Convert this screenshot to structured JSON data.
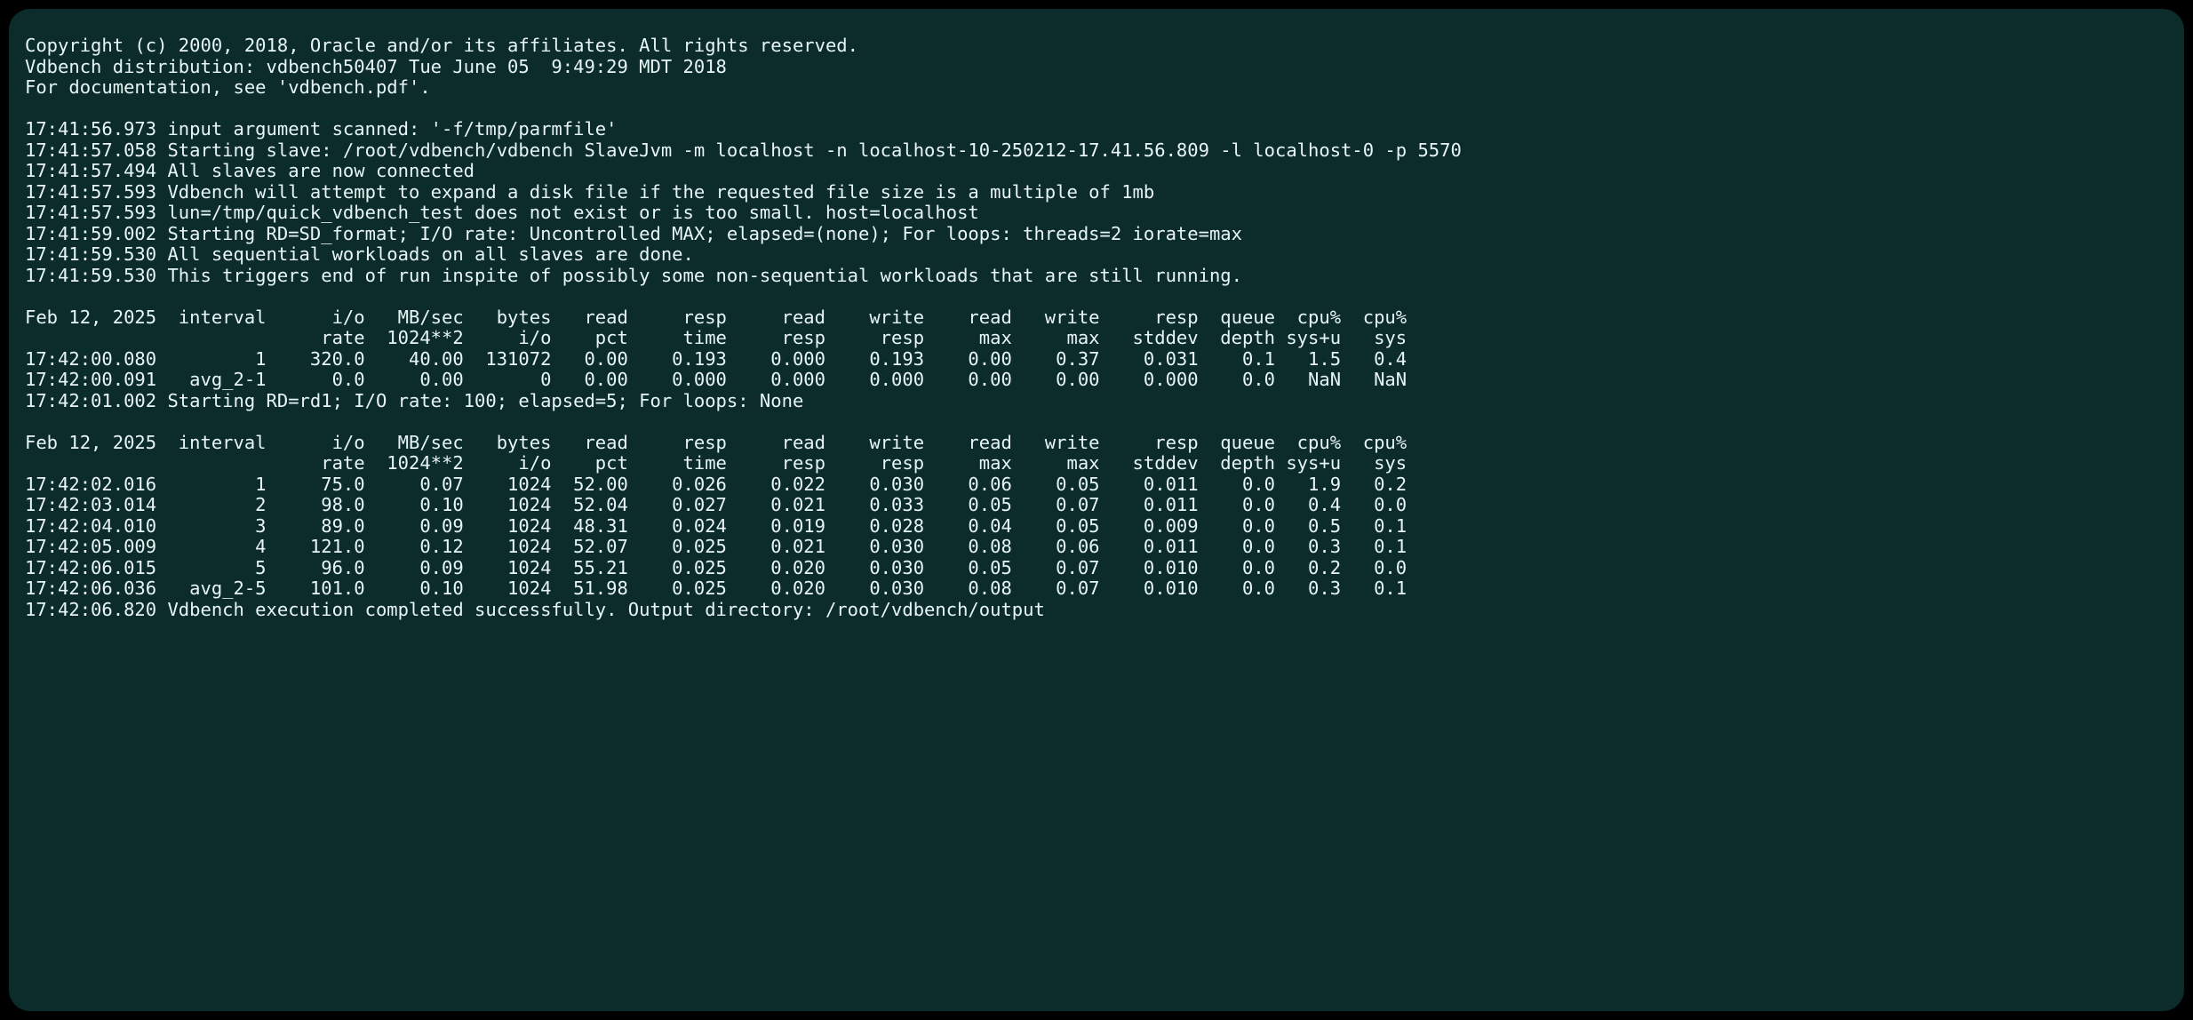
{
  "header": {
    "copyright": "Copyright (c) 2000, 2018, Oracle and/or its affiliates. All rights reserved.",
    "distribution": "Vdbench distribution: vdbench50407 Tue June 05  9:49:29 MDT 2018",
    "doc_note": "For documentation, see 'vdbench.pdf'."
  },
  "log_lines": [
    "17:41:56.973 input argument scanned: '-f/tmp/parmfile'",
    "17:41:57.058 Starting slave: /root/vdbench/vdbench SlaveJvm -m localhost -n localhost-10-250212-17.41.56.809 -l localhost-0 -p 5570",
    "17:41:57.494 All slaves are now connected",
    "17:41:57.593 Vdbench will attempt to expand a disk file if the requested file size is a multiple of 1mb",
    "17:41:57.593 lun=/tmp/quick_vdbench_test does not exist or is too small. host=localhost",
    "17:41:59.002 Starting RD=SD_format; I/O rate: Uncontrolled MAX; elapsed=(none); For loops: threads=2 iorate=max",
    "17:41:59.530 All sequential workloads on all slaves are done.",
    "17:41:59.530 This triggers end of run inspite of possibly some non-sequential workloads that are still running."
  ],
  "table1": {
    "date": "Feb 12, 2025",
    "header1": [
      "interval",
      "i/o",
      "MB/sec",
      "bytes",
      "read",
      "resp",
      "read",
      "write",
      "read",
      "write",
      "resp",
      "queue",
      "cpu%",
      "cpu%"
    ],
    "header2": [
      "",
      "rate",
      "1024**2",
      "i/o",
      "pct",
      "time",
      "resp",
      "resp",
      "max",
      "max",
      "stddev",
      "depth",
      "sys+u",
      "sys"
    ],
    "rows": [
      {
        "ts": "17:42:00.080",
        "c": [
          "1",
          "320.0",
          "40.00",
          "131072",
          "0.00",
          "0.193",
          "0.000",
          "0.193",
          "0.00",
          "0.37",
          "0.031",
          "0.1",
          "1.5",
          "0.4"
        ]
      },
      {
        "ts": "17:42:00.091",
        "c": [
          "avg_2-1",
          "0.0",
          "0.00",
          "0",
          "0.00",
          "0.000",
          "0.000",
          "0.000",
          "0.00",
          "0.00",
          "0.000",
          "0.0",
          "NaN",
          "NaN"
        ]
      }
    ]
  },
  "midline": "17:42:01.002 Starting RD=rd1; I/O rate: 100; elapsed=5; For loops: None",
  "table2": {
    "date": "Feb 12, 2025",
    "header1": [
      "interval",
      "i/o",
      "MB/sec",
      "bytes",
      "read",
      "resp",
      "read",
      "write",
      "read",
      "write",
      "resp",
      "queue",
      "cpu%",
      "cpu%"
    ],
    "header2": [
      "",
      "rate",
      "1024**2",
      "i/o",
      "pct",
      "time",
      "resp",
      "resp",
      "max",
      "max",
      "stddev",
      "depth",
      "sys+u",
      "sys"
    ],
    "rows": [
      {
        "ts": "17:42:02.016",
        "c": [
          "1",
          "75.0",
          "0.07",
          "1024",
          "52.00",
          "0.026",
          "0.022",
          "0.030",
          "0.06",
          "0.05",
          "0.011",
          "0.0",
          "1.9",
          "0.2"
        ]
      },
      {
        "ts": "17:42:03.014",
        "c": [
          "2",
          "98.0",
          "0.10",
          "1024",
          "52.04",
          "0.027",
          "0.021",
          "0.033",
          "0.05",
          "0.07",
          "0.011",
          "0.0",
          "0.4",
          "0.0"
        ]
      },
      {
        "ts": "17:42:04.010",
        "c": [
          "3",
          "89.0",
          "0.09",
          "1024",
          "48.31",
          "0.024",
          "0.019",
          "0.028",
          "0.04",
          "0.05",
          "0.009",
          "0.0",
          "0.5",
          "0.1"
        ]
      },
      {
        "ts": "17:42:05.009",
        "c": [
          "4",
          "121.0",
          "0.12",
          "1024",
          "52.07",
          "0.025",
          "0.021",
          "0.030",
          "0.08",
          "0.06",
          "0.011",
          "0.0",
          "0.3",
          "0.1"
        ]
      },
      {
        "ts": "17:42:06.015",
        "c": [
          "5",
          "96.0",
          "0.09",
          "1024",
          "55.21",
          "0.025",
          "0.020",
          "0.030",
          "0.05",
          "0.07",
          "0.010",
          "0.0",
          "0.2",
          "0.0"
        ]
      },
      {
        "ts": "17:42:06.036",
        "c": [
          "avg_2-5",
          "101.0",
          "0.10",
          "1024",
          "51.98",
          "0.025",
          "0.020",
          "0.030",
          "0.08",
          "0.07",
          "0.010",
          "0.0",
          "0.3",
          "0.1"
        ]
      }
    ]
  },
  "footer": "17:42:06.820 Vdbench execution completed successfully. Output directory: /root/vdbench/output"
}
